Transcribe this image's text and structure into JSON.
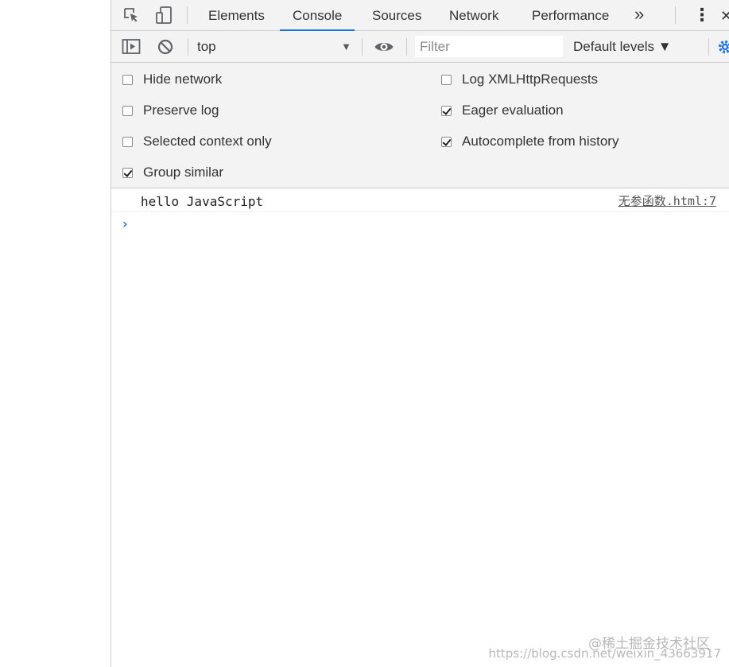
{
  "tabs": [
    {
      "label": "Elements",
      "active": false
    },
    {
      "label": "Console",
      "active": true
    },
    {
      "label": "Sources",
      "active": false
    },
    {
      "label": "Network",
      "active": false
    },
    {
      "label": "Performance",
      "active": false
    }
  ],
  "tabbar": {
    "more_tabs_glyph": "»",
    "menu_glyph": "⋮",
    "close_glyph": "✕"
  },
  "toolbar": {
    "context": "top",
    "context_arrow": "▼",
    "filter_placeholder": "Filter",
    "filter_value": "",
    "levels_label": "Default levels ▼"
  },
  "settings": {
    "left": [
      {
        "label": "Hide network",
        "checked": false
      },
      {
        "label": "Preserve log",
        "checked": false
      },
      {
        "label": "Selected context only",
        "checked": false
      },
      {
        "label": "Group similar",
        "checked": true
      }
    ],
    "right": [
      {
        "label": "Log XMLHttpRequests",
        "checked": false
      },
      {
        "label": "Eager evaluation",
        "checked": true
      },
      {
        "label": "Autocomplete from history",
        "checked": true
      }
    ]
  },
  "console": {
    "messages": [
      {
        "text": "hello JavaScript",
        "source": "无参函数.html:7"
      }
    ],
    "prompt_glyph": "›"
  },
  "watermark": {
    "line1": "@稀土掘金技术社区",
    "line2": "https://blog.csdn.net/weixin_43663917"
  },
  "colors": {
    "accent": "#1a73e8",
    "toolbar_bg": "#f3f3f3",
    "border": "#cccccc"
  }
}
